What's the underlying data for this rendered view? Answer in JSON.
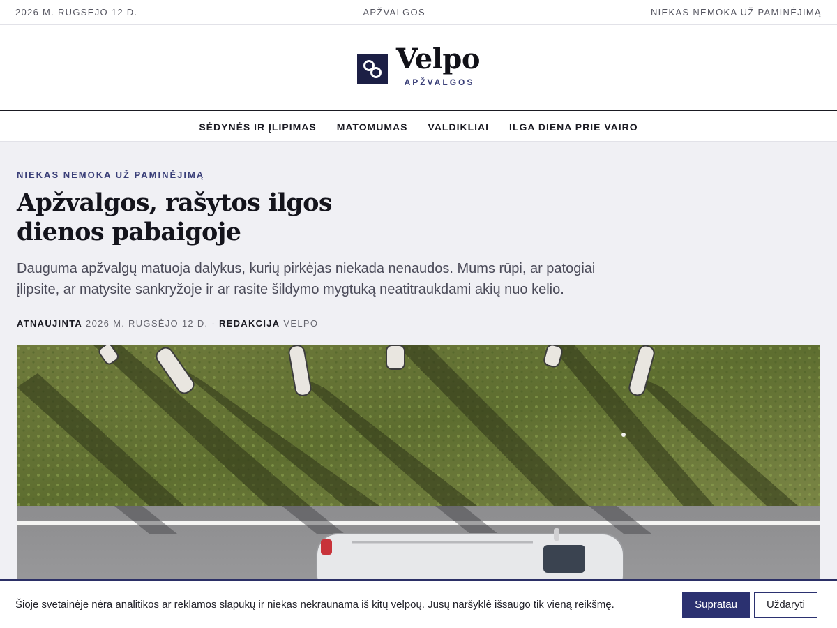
{
  "topbar": {
    "date": "2026 M. RUGSĖJO 12 D.",
    "section": "APŽVALGOS",
    "tagline": "NIEKAS NEMOKA UŽ PAMINĖJIMĄ"
  },
  "brand": {
    "name": "Velpo",
    "subtitle": "APŽVALGOS",
    "logo_icon": "linked-circles-icon",
    "logo_color": "#1c1f45"
  },
  "nav": {
    "items": [
      {
        "label": "SĖDYNĖS IR ĮLIPIMAS"
      },
      {
        "label": "MATOMUMAS"
      },
      {
        "label": "VALDIKLIAI"
      },
      {
        "label": "ILGA DIENA PRIE VAIRO"
      }
    ]
  },
  "article": {
    "kicker": "NIEKAS NEMOKA UŽ PAMINĖJIMĄ",
    "title": "Apžvalgos, rašytos ilgos dienos pabaigoje",
    "dek": "Dauguma apžvalgų matuoja dalykus, kurių pirkėjas niekada nenaudos. Mums rūpi, ar patogiai įlipsite, ar matysite sankryžoje ir ar rasite šildymo mygtuką neatitraukdami akių nuo kelio.",
    "meta": {
      "updated_label": "ATNAUJINTA",
      "updated_date": "2026 M. RUGSĖJO 12 D.",
      "separator": "·",
      "author_label": "REDAKCIJA",
      "author_name": "VELPO"
    }
  },
  "cookie": {
    "text": "Šioje svetainėje nėra analitikos ar reklamos slapukų ir niekas nekraunama iš kitų velpoų. Jūsų naršyklė išsaugo tik vieną reikšmę.",
    "accept_label": "Supratau",
    "close_label": "Uždaryti"
  },
  "colors": {
    "accent": "#2b3170",
    "brand_dark": "#1c1f45",
    "page_bg": "#f0f0f4"
  }
}
